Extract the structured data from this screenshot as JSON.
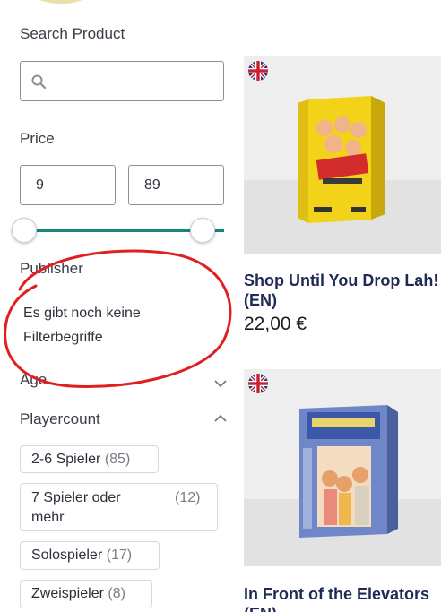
{
  "filters": {
    "search_label": "Search Product",
    "search_placeholder": "",
    "price_label": "Price",
    "price_min": "9",
    "price_max": "89",
    "publisher_label": "Publisher",
    "publisher_empty": "Es gibt noch keine Filterbegriffe",
    "age_label": "Age",
    "playercount_label": "Playercount",
    "playercount_options": [
      {
        "label": "2-6 Spieler",
        "count": "(85)"
      },
      {
        "label": "7 Spieler oder mehr",
        "count": "(12)"
      },
      {
        "label": "Solospieler",
        "count": "(17)"
      },
      {
        "label": "Zweispieler",
        "count": "(8)"
      }
    ]
  },
  "products": [
    {
      "title": "Shop Until You Drop Lah! (EN)",
      "price": "22,00 €",
      "flag": "uk-flag-icon"
    },
    {
      "title": "In Front of the Elevators (EN)",
      "price": "",
      "flag": "uk-flag-icon"
    }
  ],
  "colors": {
    "accent": "#16857a",
    "title": "#1f2b54",
    "annotation": "#e02020"
  }
}
